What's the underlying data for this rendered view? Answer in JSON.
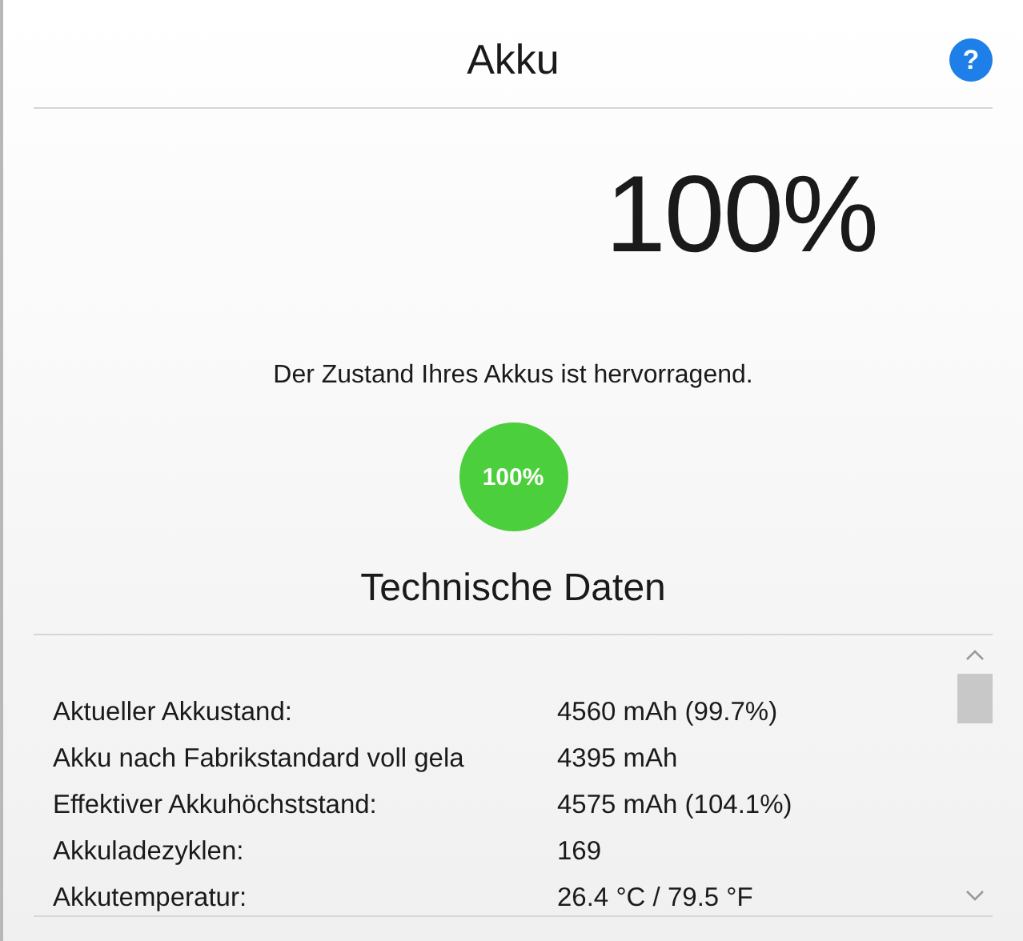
{
  "header": {
    "title": "Akku",
    "help_button": "?"
  },
  "charge_percent": "100%",
  "health": {
    "message": "Der Zustand Ihres Akkus ist hervorragend.",
    "badge": "100%"
  },
  "section_title": "Technische Daten",
  "specs": [
    {
      "label": "Aktueller Akkustand:",
      "value": "4560 mAh (99.7%)"
    },
    {
      "label": "Akku nach Fabrikstandard voll gela",
      "value": "4395 mAh"
    },
    {
      "label": "Effektiver Akkuhöchststand:",
      "value": "4575 mAh (104.1%)"
    },
    {
      "label": "Akkuladezyklen:",
      "value": "169"
    },
    {
      "label": "Akkutemperatur:",
      "value": "26.4 °C / 79.5 °F"
    }
  ]
}
